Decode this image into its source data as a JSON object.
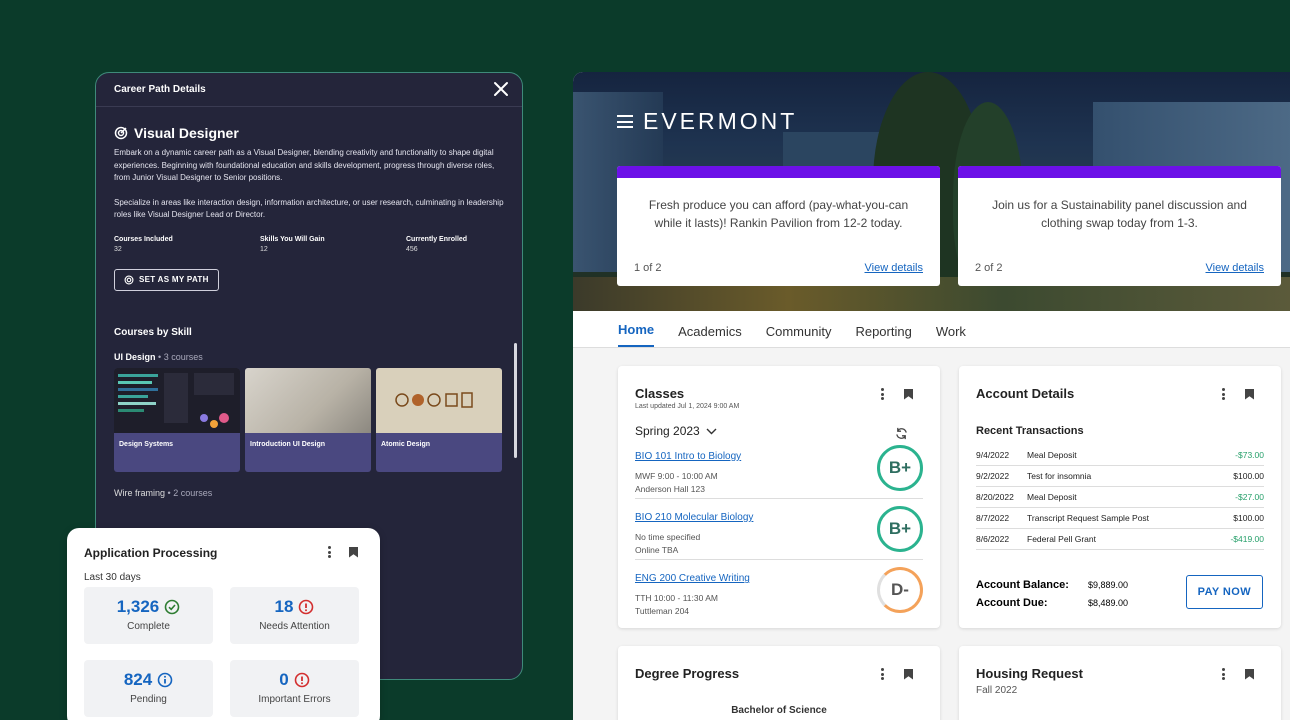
{
  "career": {
    "header": "Career Path Details",
    "path_title": "Visual Designer",
    "description_1": "Embark on a dynamic career path as a Visual Designer, blending creativity and functionality to shape digital experiences. Beginning with foundational education and skills development, progress through diverse roles, from Junior Visual Designer to Senior positions.",
    "description_2": "Specialize in areas like interaction design, information architecture, or user research, culminating in leadership roles like Visual Designer Lead or Director.",
    "stats": [
      {
        "label": "Courses Included",
        "value": "32"
      },
      {
        "label": "Skills You Will Gain",
        "value": "12"
      },
      {
        "label": "Currently Enrolled",
        "value": "456"
      }
    ],
    "set_path_label": "SET AS MY PATH",
    "courses_by_skill": "Courses by Skill",
    "skills": [
      {
        "name": "UI Design",
        "count": "3 courses"
      },
      {
        "name": "Wire framing",
        "count": "2 courses"
      }
    ],
    "courses": [
      {
        "name": "Design Systems"
      },
      {
        "name": "Introduction UI Design"
      },
      {
        "name": "Atomic Design"
      }
    ]
  },
  "app_processing": {
    "title": "Application Processing",
    "subtitle": "Last 30 days",
    "tiles": [
      {
        "value": "1,326",
        "label": "Complete",
        "icon": "check-circle-icon",
        "icon_color": "#2e7d32"
      },
      {
        "value": "18",
        "label": "Needs Attention",
        "icon": "alert-circle-icon",
        "icon_color": "#d32f2f"
      },
      {
        "value": "824",
        "label": "Pending",
        "icon": "info-circle-icon",
        "icon_color": "#1565c0"
      },
      {
        "value": "0",
        "label": "Important Errors",
        "icon": "alert-circle-icon",
        "icon_color": "#d32f2f"
      }
    ]
  },
  "portal": {
    "brand": "EVERMONT",
    "notices": [
      {
        "text": "Fresh produce you can afford (pay-what-you-can while it lasts)! Rankin Pavilion from 12-2 today.",
        "pager": "1 of 2",
        "link": "View details"
      },
      {
        "text": "Join us for a Sustainability panel discussion and clothing swap today from 1-3.",
        "pager": "2 of 2",
        "link": "View details"
      }
    ],
    "tabs": [
      "Home",
      "Academics",
      "Community",
      "Reporting",
      "Work"
    ],
    "classes": {
      "title": "Classes",
      "updated": "Last updated Jul 1, 2024 9:00 AM",
      "term": "Spring 2023",
      "items": [
        {
          "name": "BIO 101 Intro to Biology",
          "time": "MWF 9:00 - 10:00 AM",
          "place": "Anderson Hall 123",
          "grade": "B+"
        },
        {
          "name": "BIO 210 Molecular Biology",
          "time": "No time specified",
          "place": "Online TBA",
          "grade": "B+"
        },
        {
          "name": "ENG 200 Creative Writing",
          "time": "TTH 10:00 - 11:30 AM",
          "place": "Tuttleman 204",
          "grade": "D-"
        }
      ]
    },
    "account": {
      "title": "Account Details",
      "recent": "Recent Transactions",
      "transactions": [
        {
          "date": "9/4/2022",
          "desc": "Meal Deposit",
          "amount": "-$73.00"
        },
        {
          "date": "9/2/2022",
          "desc": "Test for insomnia",
          "amount": "$100.00"
        },
        {
          "date": "8/20/2022",
          "desc": "Meal Deposit",
          "amount": "-$27.00"
        },
        {
          "date": "8/7/2022",
          "desc": "Transcript Request Sample Post",
          "amount": "$100.00"
        },
        {
          "date": "8/6/2022",
          "desc": "Federal Pell Grant",
          "amount": "-$419.00"
        }
      ],
      "balance_label": "Account Balance:",
      "balance": "$9,889.00",
      "due_label": "Account Due:",
      "due": "$8,489.00",
      "pay_label": "PAY NOW"
    },
    "degree": {
      "title": "Degree Progress",
      "subtitle": "Bachelor of Science"
    },
    "housing": {
      "title": "Housing Request",
      "subtitle": "Fall 2022"
    }
  }
}
